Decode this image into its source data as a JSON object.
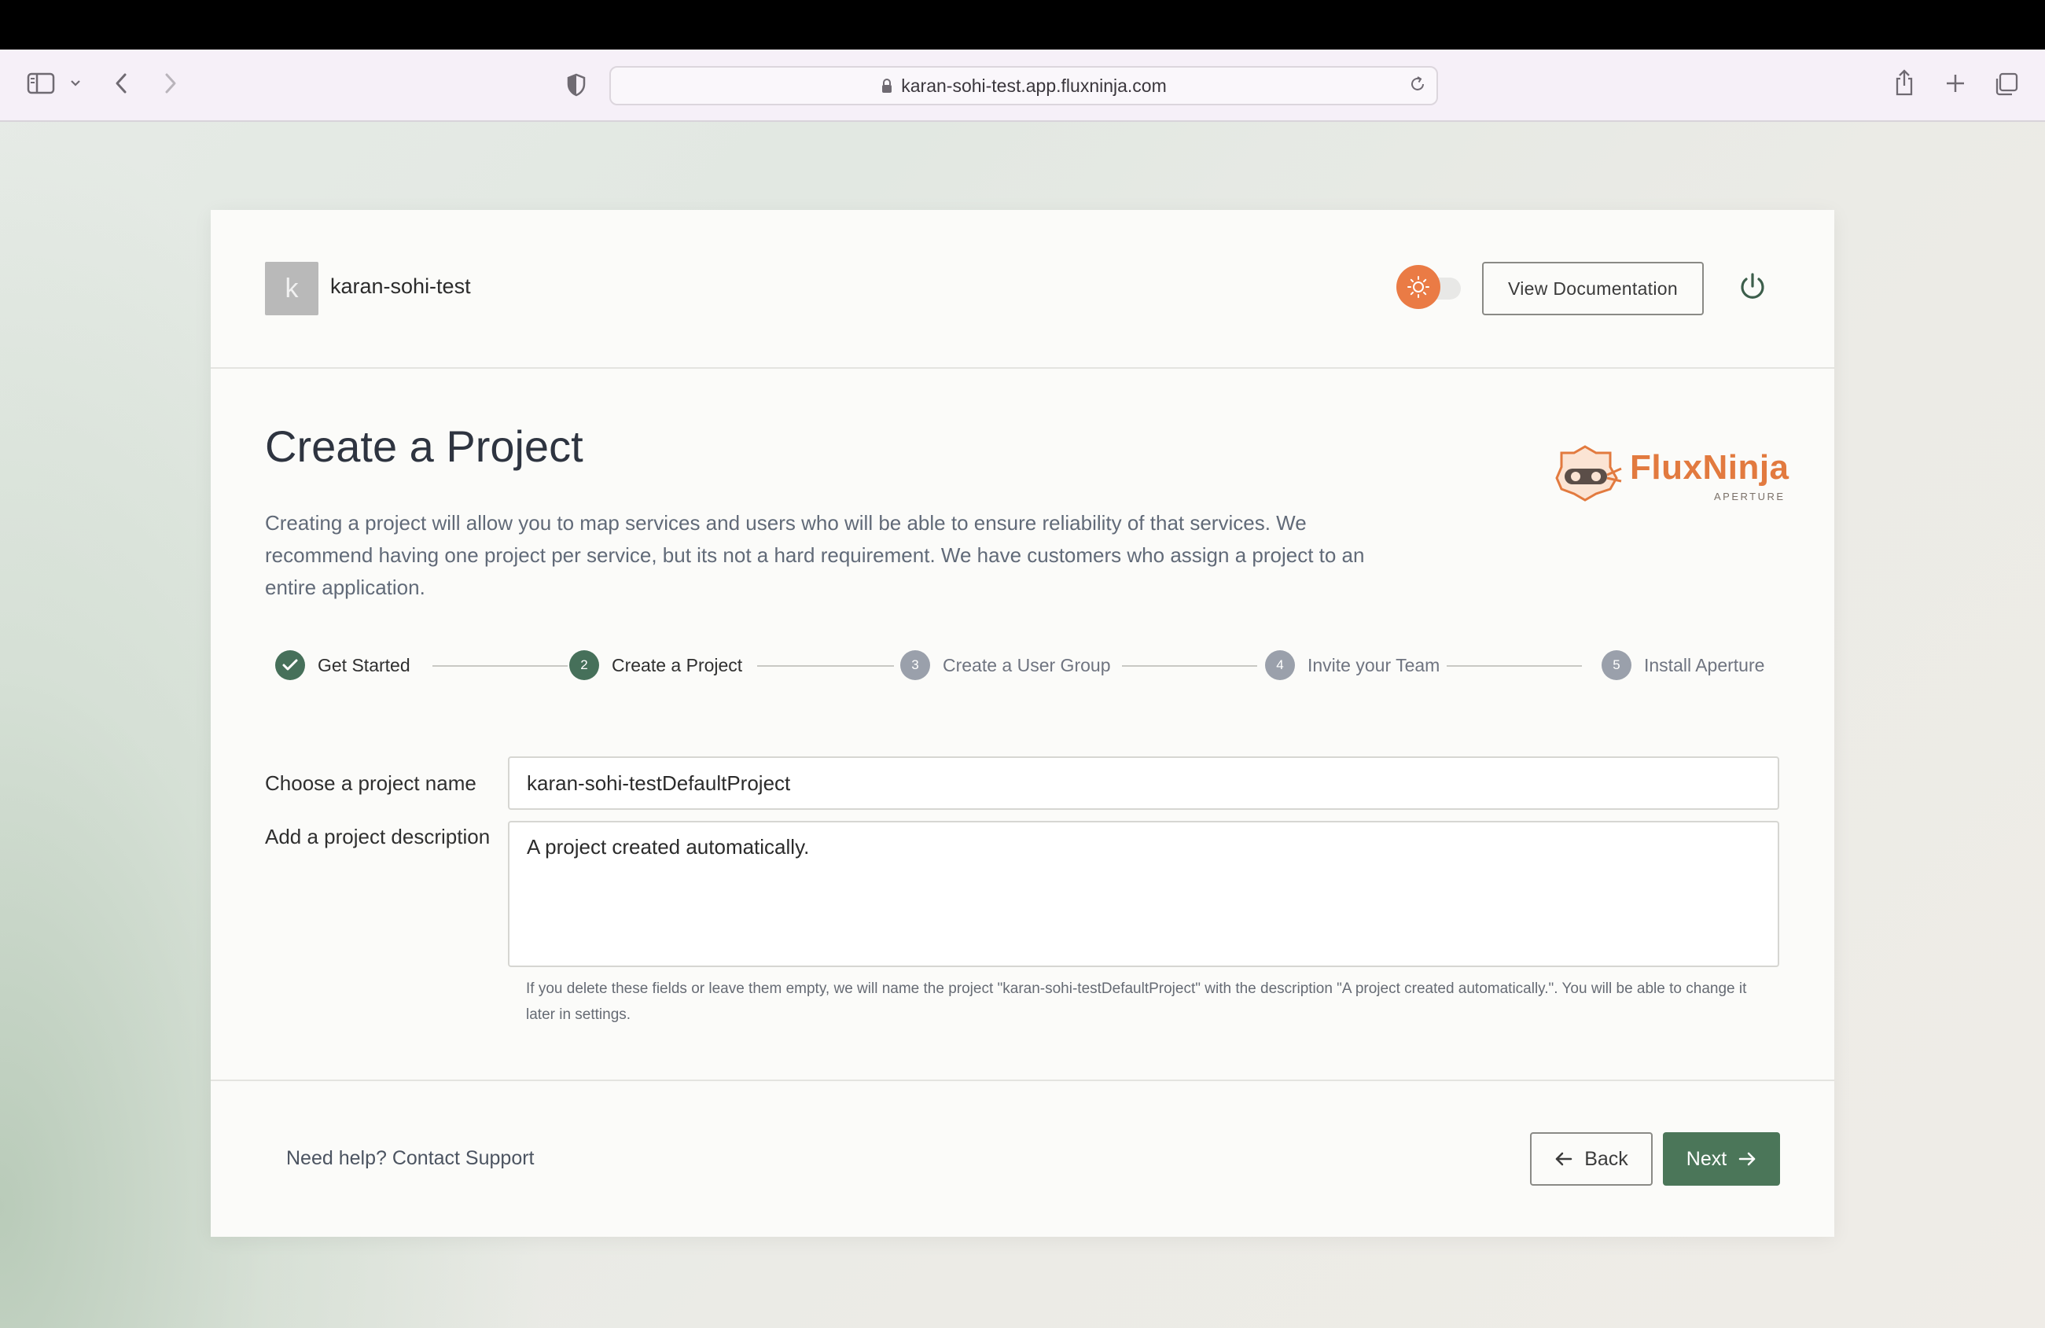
{
  "browser": {
    "url": "karan-sohi-test.app.fluxninja.com"
  },
  "header": {
    "avatar_letter": "k",
    "org_name": "karan-sohi-test",
    "view_docs_label": "View Documentation"
  },
  "main": {
    "title": "Create a Project",
    "intro": "Creating a project will allow you to map services and users who will be able to ensure reliability of that services. We recommend having one project per service, but its not a hard requirement. We have customers who assign a project to an entire application.",
    "logo_text": "FluxNinja",
    "logo_sub": "APERTURE"
  },
  "steps": [
    {
      "number": "1",
      "label": "Get Started",
      "state": "done"
    },
    {
      "number": "2",
      "label": "Create a Project",
      "state": "active"
    },
    {
      "number": "3",
      "label": "Create a User Group",
      "state": "inactive"
    },
    {
      "number": "4",
      "label": "Invite your Team",
      "state": "inactive"
    },
    {
      "number": "5",
      "label": "Install Aperture",
      "state": "inactive"
    }
  ],
  "form": {
    "name_label": "Choose a project name",
    "name_value": "karan-sohi-testDefaultProject",
    "desc_label": "Add a project description",
    "desc_value": "A project created automatically.",
    "helper": "If you delete these fields or leave them empty, we will name the project \"karan-sohi-testDefaultProject\" with the description \"A project created automatically.\". You will be able to change it later in settings."
  },
  "footer": {
    "support": "Need help? Contact Support",
    "back_label": "Back",
    "next_label": "Next"
  },
  "colors": {
    "accent_green": "#4b7659",
    "toggle_orange": "#ea7b45",
    "logo_orange": "#e27a3f"
  }
}
